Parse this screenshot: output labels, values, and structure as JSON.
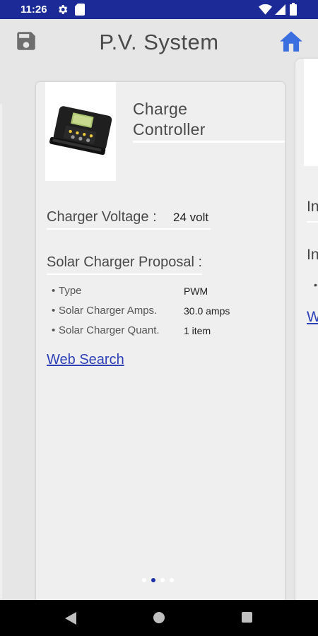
{
  "status_bar": {
    "time": "11:26"
  },
  "app_bar": {
    "title": "P.V. System"
  },
  "card": {
    "title_line1": "Charge",
    "title_line2": "Controller",
    "voltage_label": "Charger Voltage :",
    "voltage_value": "24 volt",
    "proposal_label": "Solar Charger Proposal :",
    "proposal_items": [
      {
        "label": "Type",
        "value": "PWM"
      },
      {
        "label": "Solar Charger Amps.",
        "value": "30.0 amps"
      },
      {
        "label": "Solar Charger Quant.",
        "value": "1 item"
      }
    ],
    "web_search": "Web Search"
  },
  "peek_right": {
    "text1": "In",
    "text2": "In",
    "link": "W"
  },
  "pager": {
    "count": 4,
    "active_index": 1
  },
  "colors": {
    "status_bar": "#1b2a96",
    "accent": "#2d3fb6",
    "home_icon": "#3b6fe0",
    "background": "#e6e6e6"
  }
}
